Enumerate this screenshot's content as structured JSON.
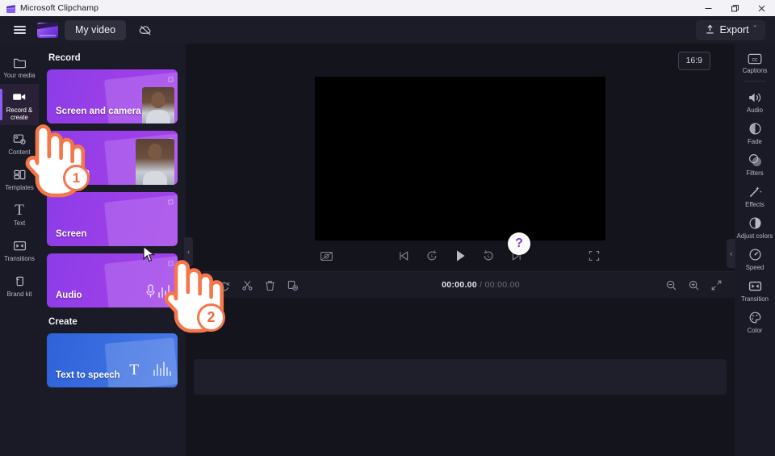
{
  "window": {
    "app_title": "Microsoft Clipchamp",
    "app_icon": "clapperboard-icon",
    "controls": {
      "minimize": "─",
      "restore": "❐",
      "close": "✕"
    }
  },
  "toolbar": {
    "menu_icon": "hamburger-menu-icon",
    "logo_icon": "clipchamp-logo-icon",
    "project_name": "My video",
    "sync_icon": "cloud-off-icon",
    "export_label": "Export",
    "export_icon": "upload-icon",
    "export_chevron": "ˇ"
  },
  "left_rail": {
    "items": [
      {
        "label": "Your media",
        "icon": "folder-icon",
        "active": false
      },
      {
        "label": "Record & create",
        "icon": "video-camera-icon",
        "active": true
      },
      {
        "label": "Content",
        "icon": "content-library-icon",
        "active": false
      },
      {
        "label": "Templates",
        "icon": "templates-grid-icon",
        "active": false
      },
      {
        "label": "Text",
        "icon": "text-t-icon",
        "active": false
      },
      {
        "label": "Transitions",
        "icon": "transitions-icon",
        "active": false
      },
      {
        "label": "Brand kit",
        "icon": "brand-kit-icon",
        "active": false
      }
    ]
  },
  "panel": {
    "sections": [
      {
        "heading": "Record",
        "cards": [
          {
            "label": "Screen and camera",
            "art": "screen-camera",
            "theme": "purple"
          },
          {
            "label": "Camera",
            "art": "camera",
            "theme": "purple"
          },
          {
            "label": "Screen",
            "art": "screen",
            "theme": "purple"
          },
          {
            "label": "Audio",
            "art": "audio",
            "theme": "purple"
          }
        ]
      },
      {
        "heading": "Create",
        "cards": [
          {
            "label": "Text to speech",
            "art": "text-to-speech",
            "theme": "blue"
          }
        ]
      }
    ],
    "collapse_icon": "‹"
  },
  "preview": {
    "aspect_ratio": "16:9",
    "help_label": "?",
    "collapse_icon": "‹",
    "controls": [
      {
        "name": "capture-frame-button",
        "icon": "image-capture-icon"
      },
      {
        "name": "skip-to-start-button",
        "icon": "skip-back-icon"
      },
      {
        "name": "rewind-button",
        "icon": "rewind-5s-icon"
      },
      {
        "name": "play-button",
        "icon": "play-icon"
      },
      {
        "name": "forward-button",
        "icon": "forward-5s-icon"
      },
      {
        "name": "skip-to-end-button",
        "icon": "skip-forward-icon"
      },
      {
        "name": "fullscreen-button",
        "icon": "fullscreen-icon"
      }
    ]
  },
  "timeline": {
    "buttons": [
      {
        "name": "undo-button",
        "icon": "undo-arrow-icon"
      },
      {
        "name": "redo-button",
        "icon": "redo-arrow-icon"
      },
      {
        "name": "split-button",
        "icon": "scissors-icon"
      },
      {
        "name": "delete-button",
        "icon": "trash-icon"
      },
      {
        "name": "duplicate-button",
        "icon": "duplicate-icon"
      }
    ],
    "current_time": "00:00.00",
    "separator": " / ",
    "total_time": "00:00.00",
    "zoom_out_icon": "zoom-out-icon",
    "zoom_in_icon": "zoom-in-icon",
    "fit_icon": "fit-to-screen-icon"
  },
  "right_rail": {
    "items": [
      {
        "label": "Captions",
        "icon": "closed-captions-icon",
        "divider_after": true
      },
      {
        "label": "Audio",
        "icon": "speaker-icon",
        "divider_after": false
      },
      {
        "label": "Fade",
        "icon": "fade-icon",
        "divider_after": false
      },
      {
        "label": "Filters",
        "icon": "filters-icon",
        "divider_after": false
      },
      {
        "label": "Effects",
        "icon": "magic-wand-icon",
        "divider_after": false
      },
      {
        "label": "Adjust colors",
        "icon": "contrast-icon",
        "divider_after": false
      },
      {
        "label": "Speed",
        "icon": "speedometer-icon",
        "divider_after": false
      },
      {
        "label": "Transition",
        "icon": "transition-icon",
        "divider_after": false
      },
      {
        "label": "Color",
        "icon": "palette-icon",
        "divider_after": false
      }
    ]
  },
  "annotations": {
    "step_one": "1",
    "step_two": "2",
    "hand_icon": "pointing-hand-cursor-icon",
    "mouse_icon": "mouse-pointer-icon",
    "accent_color": "#f4764a"
  },
  "colors": {
    "app_bg": "#14141c",
    "panel_bg": "#1b1b27",
    "rail_bg": "#1a1a26",
    "accent_purple": "#8b5cf6",
    "card_purple": "#9a3fe8",
    "card_blue": "#3a6ee0",
    "annotation_orange": "#f4764a"
  }
}
